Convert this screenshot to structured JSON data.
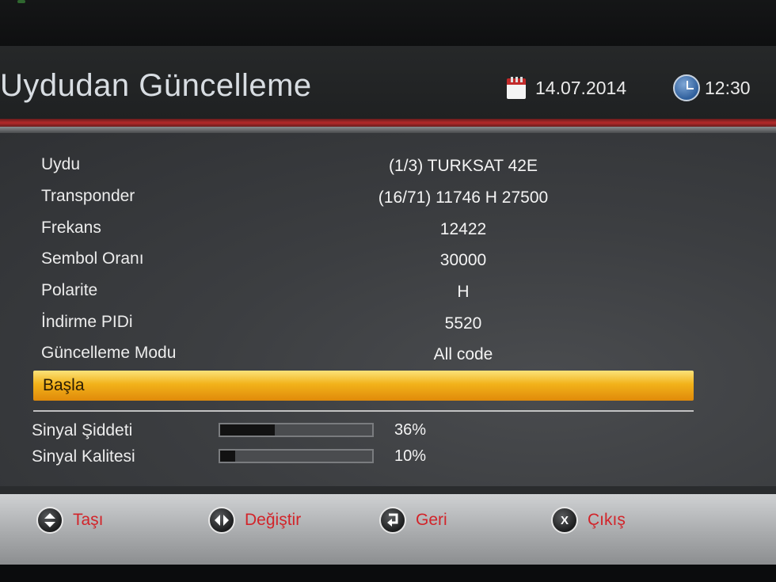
{
  "header": {
    "title": "Uydudan Güncelleme",
    "date": "14.07.2014",
    "time": "12:30",
    "date_icon": "calendar-icon",
    "time_icon": "clock-icon"
  },
  "settings": [
    {
      "label": "Uydu",
      "value": "(1/3) TURKSAT 42E"
    },
    {
      "label": "Transponder",
      "value": "(16/71) 11746 H 27500"
    },
    {
      "label": "Frekans",
      "value": "12422"
    },
    {
      "label": "Sembol Oranı",
      "value": "30000"
    },
    {
      "label": "Polarite",
      "value": "H"
    },
    {
      "label": "İndirme PIDi",
      "value": "5520"
    },
    {
      "label": "Güncelleme Modu",
      "value": "All code"
    }
  ],
  "start_button": {
    "label": "Başla",
    "color": "#f2b21a"
  },
  "signal": {
    "strength": {
      "label": "Sinyal Şiddeti",
      "percent_text": "36%",
      "level": 0.36
    },
    "quality": {
      "label": "Sinyal Kalitesi",
      "percent_text": "10%",
      "level": 0.1
    }
  },
  "footer": {
    "move": {
      "label": "Taşı",
      "icon": "up-down-arrows-icon"
    },
    "change": {
      "label": "Değiştir",
      "icon": "left-right-arrows-icon"
    },
    "back": {
      "label": "Geri",
      "icon": "return-arrow-icon"
    },
    "exit": {
      "label": "Çıkış",
      "icon": "exit-x-icon"
    }
  },
  "colors": {
    "accent_red": "#b52a2a",
    "footer_label": "#d2242a",
    "highlight": "#f2b21a"
  }
}
